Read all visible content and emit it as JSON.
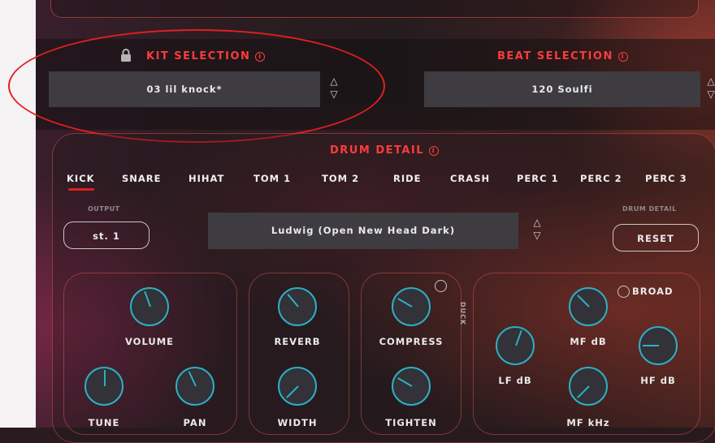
{
  "kit": {
    "title": "KIT SELECTION",
    "value": "03 lil knock*",
    "info_icon": "ⓘ"
  },
  "beat": {
    "title": "BEAT SELECTION",
    "value": "120 Soulfi"
  },
  "drum_detail": {
    "title": "DRUM DETAIL",
    "tabs": [
      "KICK",
      "SNARE",
      "HIHAT",
      "TOM 1",
      "TOM 2",
      "RIDE",
      "CRASH",
      "PERC 1",
      "PERC 2",
      "PERC 3"
    ],
    "active_tab": "KICK",
    "output_label": "OUTPUT",
    "output_value": "st. 1",
    "drum_name": "Ludwig (Open New Head Dark)",
    "reset_label_top": "DRUM DETAIL",
    "reset_button": "RESET"
  },
  "knobs": {
    "volume": "VOLUME",
    "tune": "TUNE",
    "pan": "PAN",
    "reverb": "REVERB",
    "width": "WIDTH",
    "compress": "COMPRESS",
    "tighten": "TIGHTEN",
    "duck": "DUCK",
    "broad": "BROAD",
    "mf_db": "MF dB",
    "lf_db": "LF dB",
    "hf_db": "HF dB",
    "mf_khz": "MF kHz"
  },
  "colors": {
    "accent_red": "#ff3b3b",
    "knob_teal": "#2bb0c4",
    "annotation_red": "#e02020"
  }
}
